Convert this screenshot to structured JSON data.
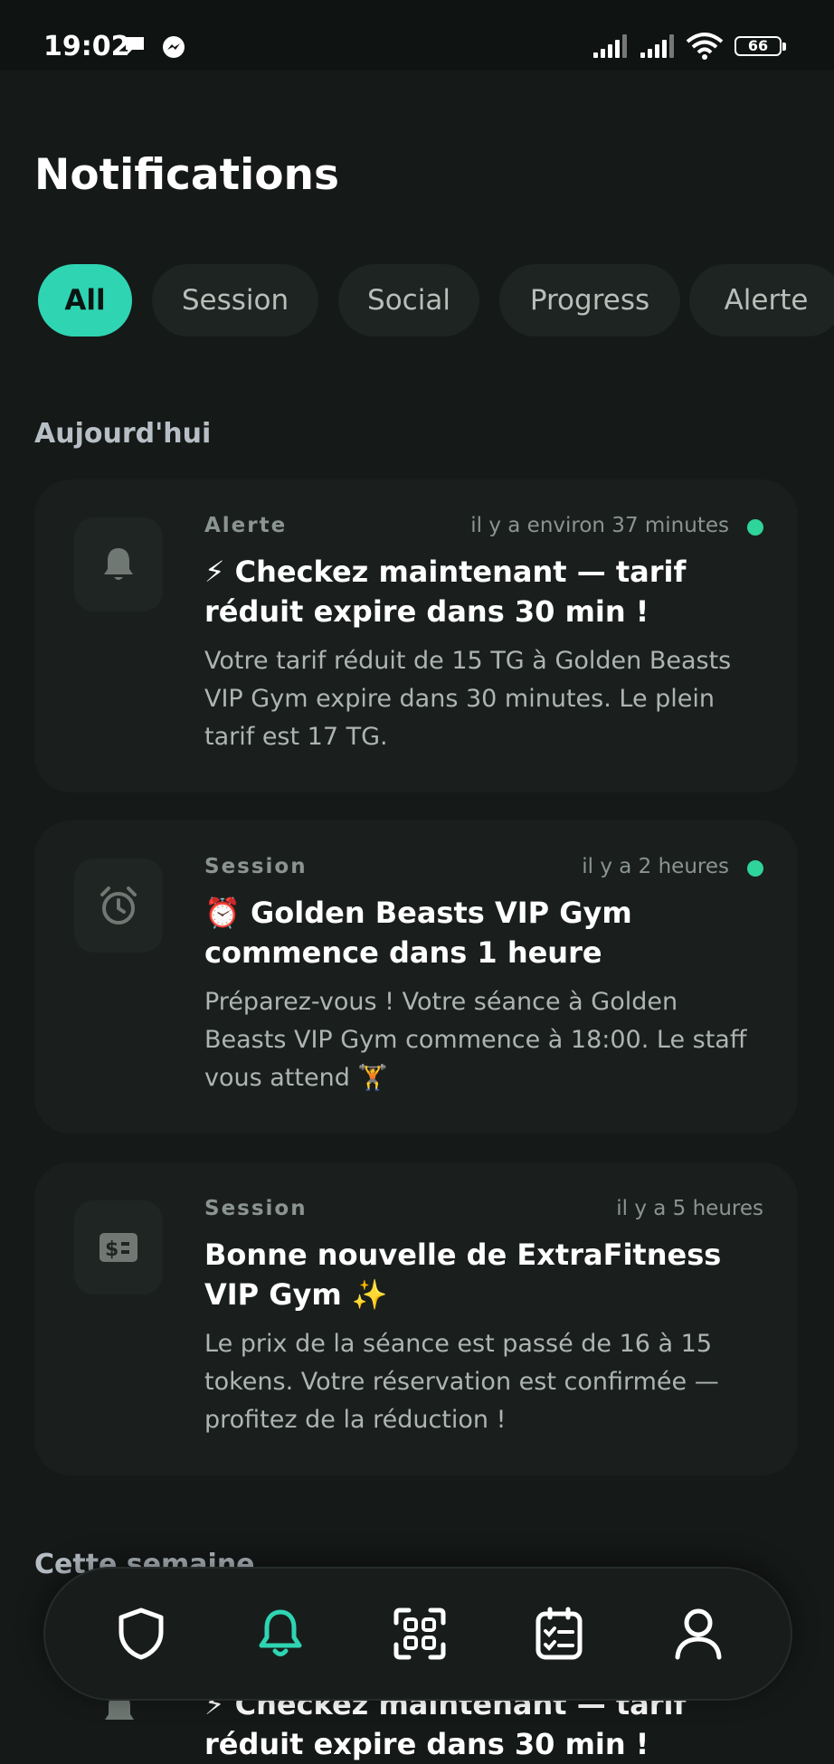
{
  "status_bar": {
    "time": "19:02",
    "battery": "66",
    "icons": [
      "chat-bubble-icon",
      "messenger-icon",
      "signal-icon",
      "signal-icon",
      "wifi-icon",
      "battery-icon"
    ]
  },
  "page": {
    "title": "Notifications"
  },
  "tabs": [
    {
      "label": "All",
      "active": true
    },
    {
      "label": "Session",
      "active": false
    },
    {
      "label": "Social",
      "active": false
    },
    {
      "label": "Progress",
      "active": false
    },
    {
      "label": "Alerte",
      "active": false
    }
  ],
  "sections": [
    {
      "label": "Aujourd'hui",
      "notifications": [
        {
          "icon": "bell-icon",
          "category": "Alerte",
          "time": "il y a environ 37 minutes",
          "unread": true,
          "title": "⚡ Checkez maintenant — tarif réduit expire dans 30 min !",
          "body": "Votre tarif réduit de 15 TG à Golden Beasts VIP Gym expire dans 30 minutes. Le plein tarif est 17 TG."
        },
        {
          "icon": "alarm-clock-icon",
          "category": "Session",
          "time": "il y a 2 heures",
          "unread": true,
          "title": "⏰ Golden Beasts VIP Gym commence dans 1 heure",
          "body": "Préparez-vous ! Votre séance à Golden Beasts VIP Gym commence à 18:00. Le staff vous attend 🏋️"
        },
        {
          "icon": "price-tag-icon",
          "category": "Session",
          "time": "il y a 5 heures",
          "unread": false,
          "title": "Bonne nouvelle de ExtraFitness VIP Gym ✨",
          "body": "Le prix de la séance est passé de 16 à 15 tokens. Votre réservation est confirmée — profitez de la réduction !"
        }
      ]
    },
    {
      "label": "Cette semaine",
      "peek_title": "⚡ Checkez maintenant — tarif réduit expire dans 30 min !"
    }
  ],
  "bottom_nav": [
    {
      "icon": "shield-icon",
      "active": false
    },
    {
      "icon": "bell-icon",
      "active": true
    },
    {
      "icon": "qr-scan-icon",
      "active": false
    },
    {
      "icon": "checklist-icon",
      "active": false
    },
    {
      "icon": "profile-icon",
      "active": false
    }
  ],
  "colors": {
    "background": "#151917",
    "card": "#1a1f1d",
    "accent": "#2fd4b3",
    "unread_dot": "#2fd49a",
    "muted_text": "#aeb4b1"
  }
}
